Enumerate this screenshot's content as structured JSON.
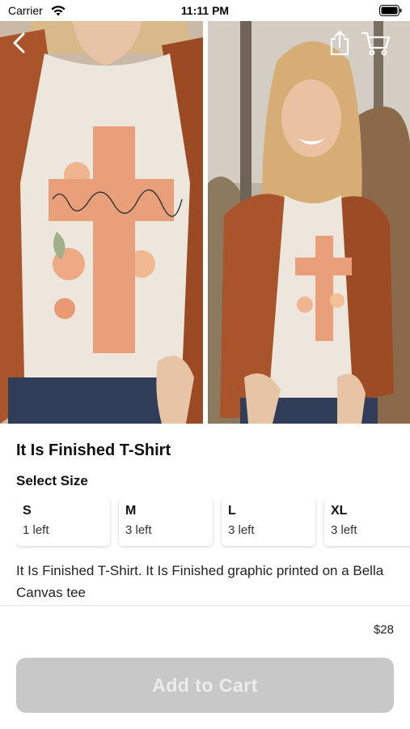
{
  "status_bar": {
    "carrier": "Carrier",
    "time": "11:11 PM"
  },
  "nav": {
    "icons": [
      "back-icon",
      "share-icon",
      "cart-icon"
    ]
  },
  "product": {
    "title": "It Is Finished T-Shirt",
    "select_size_label": "Select Size",
    "sizes": [
      {
        "label": "S",
        "stock": "1 left"
      },
      {
        "label": "M",
        "stock": "3 left"
      },
      {
        "label": "L",
        "stock": "3 left"
      },
      {
        "label": "XL",
        "stock": "3 left"
      }
    ],
    "description": "It Is Finished T-Shirt. It Is Finished graphic printed on a Bella Canvas tee",
    "price": "$28"
  },
  "cart_button": {
    "label": "Add to Cart",
    "enabled": false
  },
  "colors": {
    "button_disabled": "#c8c8c8",
    "button_text_disabled": "#ececec",
    "jacket": "#a9542b",
    "shirt": "#ece6dc",
    "cross": "#e9a07a"
  }
}
